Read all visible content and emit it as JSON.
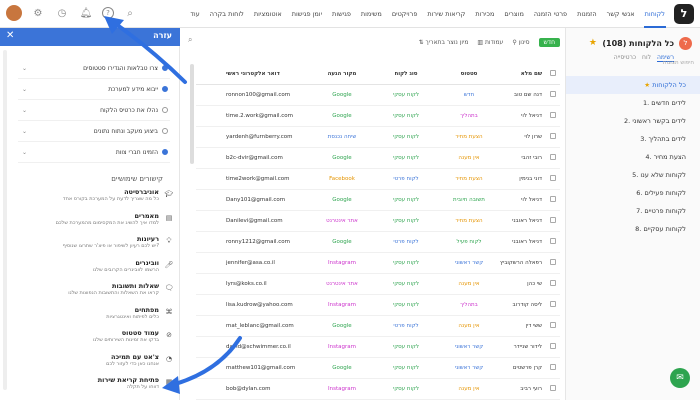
{
  "topnav": {
    "logo": "ל",
    "items": [
      "לקוחות",
      "אנשי קשר",
      "הזמנות",
      "פרטי הזמנה",
      "מוצרים",
      "מכירות",
      "קריאות שירות",
      "פרויקטים",
      "משימות",
      "פגישות",
      "יומן פגישות",
      "אוטומציות",
      "לוחות בקרה",
      "עוד"
    ],
    "active_index": 0
  },
  "sidebar": {
    "title": "כל הלקוחות (108)",
    "badge": "ל",
    "tabs": [
      "רשימה",
      "לוח",
      "כרטיסייה"
    ],
    "search_placeholder": "חיפוש תצוגות",
    "views": [
      "כל הלקוחות",
      "1. לידים חדשים",
      "2. לידים בקשר ראשוני",
      "3. לידים בתהליך",
      "4. הצעת מחיר",
      "5. לקוחות שלא ענו",
      "6. לקוחות פעילים",
      "7. לקוחות פרטיים",
      "8. לקוחות עסקיים"
    ]
  },
  "panel": {
    "title": "עזרה",
    "close": "✕",
    "checklist": [
      {
        "label": "צרו טבלאות והגדירו סטטוסים",
        "done": true
      },
      {
        "label": "ייבוא מידע למערכת",
        "done": true
      },
      {
        "label": "נהלו את כרטיס הלקוח",
        "done": false
      },
      {
        "label": "ביצוע מעקב ונתוח נתונים",
        "done": false
      },
      {
        "label": "הזמינו חברי צוות",
        "done": true
      }
    ],
    "section_title": "קישורים שימושיים",
    "links": [
      {
        "title": "אוניברסיטה",
        "desc": "כל מה שצריך לדעת על המערכת בקורס אחד",
        "icon": "graduation-cap-icon"
      },
      {
        "title": "מאמרים",
        "desc": "למדו איך להשיג את המקסימום מהמערכת שלכם",
        "icon": "article-icon"
      },
      {
        "title": "רעיונות",
        "desc": "יש לכם רעיון לשיפור או פיצ'ר שתרצו שנוסיף?",
        "icon": "lightbulb-icon"
      },
      {
        "title": "וובינרים",
        "desc": "הרשמו לוובינרים הקרובים שלנו",
        "icon": "mic-icon"
      },
      {
        "title": "שאלות ותשובות",
        "desc": "קראו את השאלות והתשובות הנפוצות שלנו",
        "icon": "chat-icon"
      },
      {
        "title": "מפתחים",
        "desc": "כלים לפיתוח ואינטגרציות",
        "icon": "code-icon"
      },
      {
        "title": "עמוד סטטוס",
        "desc": "בדקו את זמינות השירותים שלנו",
        "icon": "status-icon"
      },
      {
        "title": "צ'אט עם תמיכה",
        "desc": "אנחנו כאן כדי לעזור לכם",
        "icon": "support-icon"
      },
      {
        "title": "פתיחת קריאת שירות",
        "desc": "דווחו על תקלה",
        "icon": "ticket-icon"
      }
    ]
  },
  "toolbar": {
    "new_label": "חדש",
    "filter_label": "סינון",
    "columns_label": "עמודות",
    "sort_label": "מיון נוצר בתאריך"
  },
  "table": {
    "headers": [
      "שם מלא",
      "סטטוס",
      "סוג לקוח",
      "מקור הגעה",
      "דואר אלקטרוני ראשי"
    ],
    "rows": [
      {
        "name": "דנה שם טוב",
        "status": "חדש",
        "status_color": "#3b74d8",
        "type": "לקוח עסקי",
        "type_color": "#2ea44f",
        "src": "Google",
        "src_color": "#2ea44f",
        "email": "ronnon100@gmail.com"
      },
      {
        "name": "דניאל לוי",
        "status": "בתהליך",
        "status_color": "#cc33cc",
        "type": "לקוח עסקי",
        "type_color": "#2ea44f",
        "src": "Google",
        "src_color": "#2ea44f",
        "email": "time.2.work@gmail.com"
      },
      {
        "name": "שרון לוי",
        "status": "הצעת מחיר",
        "status_color": "#e59400",
        "type": "לקוח עסקי",
        "type_color": "#2ea44f",
        "src": "שיחה נכנסת",
        "src_color": "#3b74d8",
        "email": "yardenh@furnberry.com"
      },
      {
        "name": "רובי זהבי",
        "status": "אין מענה",
        "status_color": "#e59400",
        "type": "לקוח עסקי",
        "type_color": "#2ea44f",
        "src": "Google",
        "src_color": "#2ea44f",
        "email": "b2c-dvir@gmail.com"
      },
      {
        "name": "דוני בנימין",
        "status": "הצעת מחיר",
        "status_color": "#e59400",
        "type": "לקוח פרטי",
        "type_color": "#3b74d8",
        "src": "Facebook",
        "src_color": "#e59400",
        "email": "time2work@gmail.com"
      },
      {
        "name": "דניאל לוי",
        "status": "תשובה חיובית",
        "status_color": "#2ea44f",
        "type": "לקוח עסקי",
        "type_color": "#2ea44f",
        "src": "Google",
        "src_color": "#2ea44f",
        "email": "Dany101@gmail.com"
      },
      {
        "name": "דניאל ראובני",
        "status": "הצעת מחיר",
        "status_color": "#e59400",
        "type": "לקוח עסקי",
        "type_color": "#2ea44f",
        "src": "אתר אינטרנט",
        "src_color": "#cc33cc",
        "email": "Danilevi@gmail.com"
      },
      {
        "name": "דניאל ראובני",
        "status": "לקוח פעיל",
        "status_color": "#2ea44f",
        "type": "לקוח פרטי",
        "type_color": "#3b74d8",
        "src": "Google",
        "src_color": "#2ea44f",
        "email": "ronny1212@gmail.com"
      },
      {
        "name": "רפאלה הרשקוביץ",
        "status": "קשר ראשוני",
        "status_color": "#3b74d8",
        "type": "לקוח עסקי",
        "type_color": "#2ea44f",
        "src": "Instagram",
        "src_color": "#cc33cc",
        "email": "jennifer@asa.co.il"
      },
      {
        "name": "שי כהן",
        "status": "אין מענה",
        "status_color": "#e59400",
        "type": "לקוח עסקי",
        "type_color": "#2ea44f",
        "src": "אתר אינטרנט",
        "src_color": "#cc33cc",
        "email": "lyrs@koks.co.il"
      },
      {
        "name": "ליסה קודרוב",
        "status": "בתהליך",
        "status_color": "#cc33cc",
        "type": "לקוח עסקי",
        "type_color": "#2ea44f",
        "src": "Instagram",
        "src_color": "#cc33cc",
        "email": "lisa.kudrow@yahoo.com"
      },
      {
        "name": "ששי דין",
        "status": "אין מענה",
        "status_color": "#e59400",
        "type": "לקוח פרטי",
        "type_color": "#3b74d8",
        "src": "Google",
        "src_color": "#2ea44f",
        "email": "mat_leblanc@gmail.com"
      },
      {
        "name": "לידור שניידר",
        "status": "קשר ראשוני",
        "status_color": "#3b74d8",
        "type": "לקוח עסקי",
        "type_color": "#2ea44f",
        "src": "Instagram",
        "src_color": "#cc33cc",
        "email": "david@schwimmer.co.il"
      },
      {
        "name": "קרן פרשטים",
        "status": "קשר ראשוני",
        "status_color": "#3b74d8",
        "type": "לקוח עסקי",
        "type_color": "#2ea44f",
        "src": "Google",
        "src_color": "#2ea44f",
        "email": "matthew101@gmail.com"
      },
      {
        "name": "רועי רביב",
        "status": "אין מענה",
        "status_color": "#e59400",
        "type": "לקוח עסקי",
        "type_color": "#2ea44f",
        "src": "Instagram",
        "src_color": "#cc33cc",
        "email": "bob@dylan.com"
      }
    ]
  },
  "colors": {
    "primary": "#3b74d8",
    "fab": "#2ea44f",
    "annotation_arrow": "#2f6fe0"
  }
}
